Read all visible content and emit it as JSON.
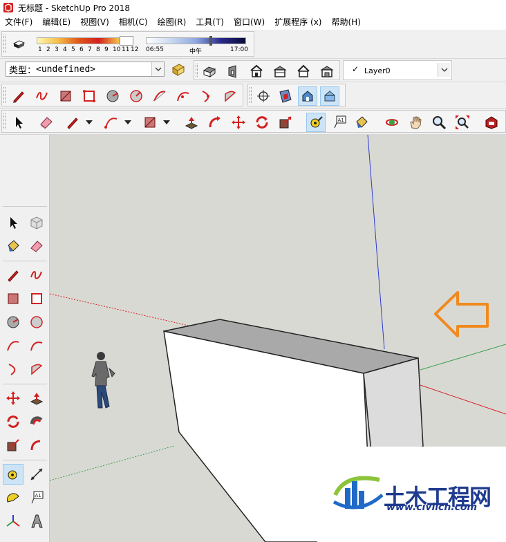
{
  "window": {
    "title": "无标题 - SketchUp Pro 2018"
  },
  "menu": [
    "文件(F)",
    "编辑(E)",
    "视图(V)",
    "相机(C)",
    "绘图(R)",
    "工具(T)",
    "窗口(W)",
    "扩展程序 (x)",
    "帮助(H)"
  ],
  "shadows": {
    "months": [
      "1",
      "2",
      "3",
      "4",
      "5",
      "6",
      "7",
      "8",
      "9",
      "10",
      "11",
      "12"
    ],
    "time_start": "06:55",
    "time_mid": "中午",
    "time_end": "17:00"
  },
  "entity_type": {
    "label": "类型：",
    "value": "<undefined>"
  },
  "layer": {
    "value": "Layer0"
  },
  "watermark": {
    "name": "土木工程网",
    "url": "www.civilcn.com"
  },
  "colors": {
    "accent_red": "#d42020",
    "orange_arrow": "#f08a1e",
    "viewport_bg": "#d9d9d4",
    "brand_blue": "#1f3b8f"
  }
}
